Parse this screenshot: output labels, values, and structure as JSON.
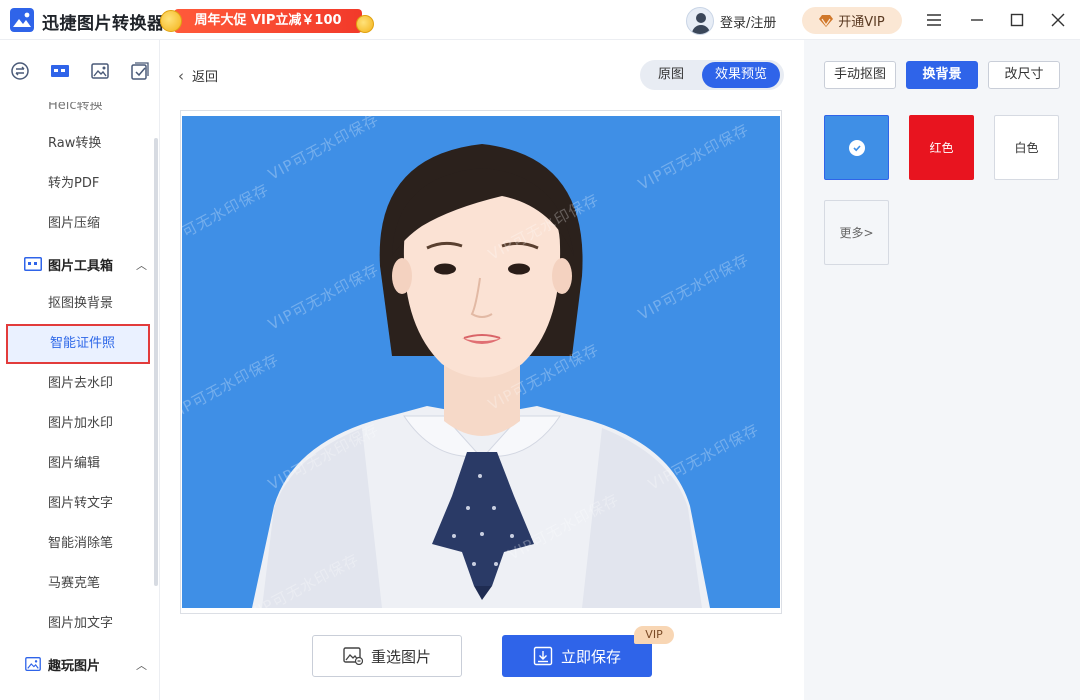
{
  "titlebar": {
    "app_title": "迅捷图片转换器",
    "promo_text": "周年大促 VIP立减￥100",
    "login_label": "登录/注册",
    "vip_label": "开通VIP"
  },
  "sidebar": {
    "items_top": [
      {
        "label": "Heic转换"
      },
      {
        "label": "Raw转换"
      },
      {
        "label": "转为PDF"
      },
      {
        "label": "图片压缩"
      }
    ],
    "group_toolbox": {
      "label": "图片工具箱",
      "expanded": true
    },
    "toolbox_items": [
      {
        "label": "抠图换背景"
      },
      {
        "label": "智能证件照",
        "active": true
      },
      {
        "label": "图片去水印"
      },
      {
        "label": "图片加水印"
      },
      {
        "label": "图片编辑"
      },
      {
        "label": "图片转文字"
      },
      {
        "label": "智能消除笔"
      },
      {
        "label": "马赛克笔"
      },
      {
        "label": "图片加文字"
      }
    ],
    "group_fun": {
      "label": "趣玩图片",
      "expanded": true
    }
  },
  "main": {
    "back_label": "返回",
    "toggle": {
      "original": "原图",
      "preview": "效果预览",
      "selected": "效果预览"
    },
    "watermark_text": "VIP可无水印保存",
    "reselect_label": "重选图片",
    "save_label": "立即保存",
    "vip_tag": "VIP"
  },
  "right_panel": {
    "tabs": [
      {
        "label": "手动抠图"
      },
      {
        "label": "换背景",
        "active": true
      },
      {
        "label": "改尺寸"
      }
    ],
    "swatches": [
      {
        "label": "",
        "color": "#3f8fe6",
        "selected": true
      },
      {
        "label": "红色",
        "color": "#e8141f"
      },
      {
        "label": "白色",
        "color": "#ffffff"
      }
    ],
    "more_label": "更多>"
  },
  "colors": {
    "accent": "#2f64e9",
    "photo_bg": "#3f8fe6",
    "highlight_border": "#e23b3b"
  }
}
